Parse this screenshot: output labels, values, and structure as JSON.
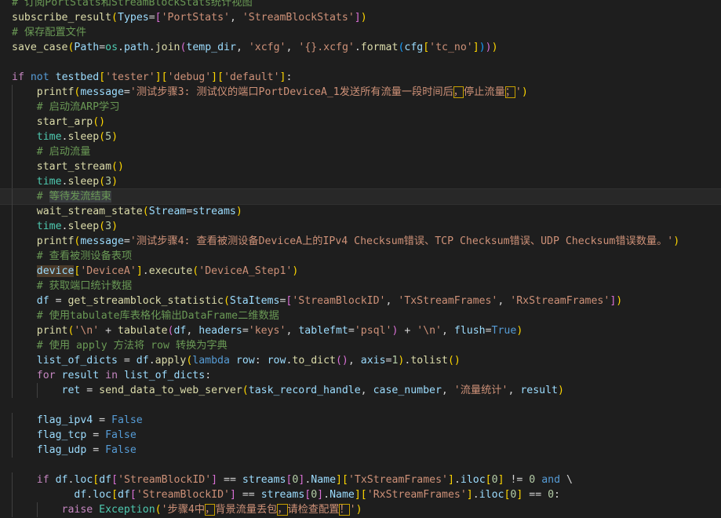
{
  "editor": {
    "lines": [
      {
        "indent": 0,
        "tokens": [
          [
            "com",
            "# 订阅PortStats和StreamBlockStats统计视图"
          ]
        ]
      },
      {
        "indent": 0,
        "tokens": [
          [
            "fn",
            "subscribe_result"
          ],
          [
            "p1",
            "("
          ],
          [
            "var",
            "Types"
          ],
          [
            "pun",
            "="
          ],
          [
            "p2",
            "["
          ],
          [
            "str",
            "'PortStats'"
          ],
          [
            "pun",
            ", "
          ],
          [
            "str",
            "'StreamBlockStats'"
          ],
          [
            "p2",
            "]"
          ],
          [
            "p1",
            ")"
          ]
        ]
      },
      {
        "indent": 0,
        "tokens": [
          [
            "com",
            "# 保存配置文件"
          ]
        ]
      },
      {
        "indent": 0,
        "tokens": [
          [
            "fn",
            "save_case"
          ],
          [
            "p1",
            "("
          ],
          [
            "var",
            "Path"
          ],
          [
            "pun",
            "="
          ],
          [
            "cls",
            "os"
          ],
          [
            "pun",
            "."
          ],
          [
            "var",
            "path"
          ],
          [
            "pun",
            "."
          ],
          [
            "fn",
            "join"
          ],
          [
            "p2",
            "("
          ],
          [
            "var",
            "temp_dir"
          ],
          [
            "pun",
            ", "
          ],
          [
            "str",
            "'xcfg'"
          ],
          [
            "pun",
            ", "
          ],
          [
            "str",
            "'{}.xcfg'"
          ],
          [
            "pun",
            "."
          ],
          [
            "fn",
            "format"
          ],
          [
            "p3",
            "("
          ],
          [
            "var",
            "cfg"
          ],
          [
            "p1",
            "["
          ],
          [
            "str",
            "'tc_no'"
          ],
          [
            "p1",
            "]"
          ],
          [
            "p3",
            ")"
          ],
          [
            "p2",
            ")"
          ],
          [
            "p1",
            ")"
          ]
        ]
      },
      {
        "indent": 0,
        "tokens": []
      },
      {
        "indent": 0,
        "tokens": [
          [
            "kw",
            "if"
          ],
          [
            "pun",
            " "
          ],
          [
            "kwb",
            "not"
          ],
          [
            "pun",
            " "
          ],
          [
            "var",
            "testbed"
          ],
          [
            "p1",
            "["
          ],
          [
            "str",
            "'tester'"
          ],
          [
            "p1",
            "]"
          ],
          [
            "p1",
            "["
          ],
          [
            "str",
            "'debug'"
          ],
          [
            "p1",
            "]"
          ],
          [
            "p1",
            "["
          ],
          [
            "str",
            "'default'"
          ],
          [
            "p1",
            "]"
          ],
          [
            "pun",
            ":"
          ]
        ]
      },
      {
        "indent": 1,
        "tokens": [
          [
            "fn",
            "printf"
          ],
          [
            "p1",
            "("
          ],
          [
            "var",
            "message"
          ],
          [
            "pun",
            "="
          ],
          [
            "str",
            "'测试步骤3: 测试仪的端口PortDeviceA_1发送所有流量一段时间后"
          ],
          [
            "box",
            "，"
          ],
          [
            "str",
            "停止流量"
          ],
          [
            "box",
            "；"
          ],
          [
            "str",
            "'"
          ],
          [
            "p1",
            ")"
          ]
        ]
      },
      {
        "indent": 1,
        "tokens": [
          [
            "com",
            "# 启动流ARP学习"
          ]
        ]
      },
      {
        "indent": 1,
        "tokens": [
          [
            "fn",
            "start_arp"
          ],
          [
            "p1",
            "()"
          ]
        ]
      },
      {
        "indent": 1,
        "tokens": [
          [
            "cls",
            "time"
          ],
          [
            "pun",
            "."
          ],
          [
            "fn",
            "sleep"
          ],
          [
            "p1",
            "("
          ],
          [
            "num",
            "5"
          ],
          [
            "p1",
            ")"
          ]
        ]
      },
      {
        "indent": 1,
        "tokens": [
          [
            "com",
            "# 启动流量"
          ]
        ]
      },
      {
        "indent": 1,
        "tokens": [
          [
            "fn",
            "start_stream"
          ],
          [
            "p1",
            "()"
          ]
        ]
      },
      {
        "indent": 1,
        "tokens": [
          [
            "cls",
            "time"
          ],
          [
            "pun",
            "."
          ],
          [
            "fn",
            "sleep"
          ],
          [
            "p1",
            "("
          ],
          [
            "num",
            "3"
          ],
          [
            "p1",
            ")"
          ]
        ]
      },
      {
        "indent": 1,
        "current": true,
        "tokens": [
          [
            "com",
            "# "
          ],
          [
            "hl",
            "等待发流结束"
          ]
        ]
      },
      {
        "indent": 1,
        "tokens": [
          [
            "fn",
            "wait_stream_state"
          ],
          [
            "p1",
            "("
          ],
          [
            "var",
            "Stream"
          ],
          [
            "pun",
            "="
          ],
          [
            "var",
            "streams"
          ],
          [
            "p1",
            ")"
          ]
        ]
      },
      {
        "indent": 1,
        "tokens": [
          [
            "cls",
            "time"
          ],
          [
            "pun",
            "."
          ],
          [
            "fn",
            "sleep"
          ],
          [
            "p1",
            "("
          ],
          [
            "num",
            "3"
          ],
          [
            "p1",
            ")"
          ]
        ]
      },
      {
        "indent": 1,
        "tokens": [
          [
            "fn",
            "printf"
          ],
          [
            "p1",
            "("
          ],
          [
            "var",
            "message"
          ],
          [
            "pun",
            "="
          ],
          [
            "str",
            "'测试步骤4: 查看被测设备DeviceA上的IPv4 Checksum错误、TCP Checksum错误、UDP Checksum错误数量。'"
          ],
          [
            "p1",
            ")"
          ]
        ]
      },
      {
        "indent": 1,
        "tokens": [
          [
            "com",
            "# 查看被测设备表项"
          ]
        ]
      },
      {
        "indent": 1,
        "tokens": [
          [
            "hlv",
            "device"
          ],
          [
            "p1",
            "["
          ],
          [
            "str",
            "'DeviceA'"
          ],
          [
            "p1",
            "]"
          ],
          [
            "pun",
            "."
          ],
          [
            "fn",
            "execute"
          ],
          [
            "p1",
            "("
          ],
          [
            "str",
            "'DeviceA_Step1'"
          ],
          [
            "p1",
            ")"
          ]
        ]
      },
      {
        "indent": 1,
        "tokens": [
          [
            "com",
            "# 获取端口统计数据"
          ]
        ]
      },
      {
        "indent": 1,
        "tokens": [
          [
            "var",
            "df"
          ],
          [
            "pun",
            " = "
          ],
          [
            "fn",
            "get_streamblock_statistic"
          ],
          [
            "p1",
            "("
          ],
          [
            "var",
            "StaItems"
          ],
          [
            "pun",
            "="
          ],
          [
            "p2",
            "["
          ],
          [
            "str",
            "'StreamBlockID'"
          ],
          [
            "pun",
            ", "
          ],
          [
            "str",
            "'TxStreamFrames'"
          ],
          [
            "pun",
            ", "
          ],
          [
            "str",
            "'RxStreamFrames'"
          ],
          [
            "p2",
            "]"
          ],
          [
            "p1",
            ")"
          ]
        ]
      },
      {
        "indent": 1,
        "tokens": [
          [
            "com",
            "# 使用tabulate库表格化输出DataFrame二维数据"
          ]
        ]
      },
      {
        "indent": 1,
        "tokens": [
          [
            "fn",
            "print"
          ],
          [
            "p1",
            "("
          ],
          [
            "str",
            "'\\n'"
          ],
          [
            "pun",
            " + "
          ],
          [
            "fn",
            "tabulate"
          ],
          [
            "p2",
            "("
          ],
          [
            "var",
            "df"
          ],
          [
            "pun",
            ", "
          ],
          [
            "var",
            "headers"
          ],
          [
            "pun",
            "="
          ],
          [
            "str",
            "'keys'"
          ],
          [
            "pun",
            ", "
          ],
          [
            "var",
            "tablefmt"
          ],
          [
            "pun",
            "="
          ],
          [
            "str",
            "'psql'"
          ],
          [
            "p2",
            ")"
          ],
          [
            "pun",
            " + "
          ],
          [
            "str",
            "'\\n'"
          ],
          [
            "pun",
            ", "
          ],
          [
            "var",
            "flush"
          ],
          [
            "pun",
            "="
          ],
          [
            "kwb",
            "True"
          ],
          [
            "p1",
            ")"
          ]
        ]
      },
      {
        "indent": 1,
        "tokens": [
          [
            "com",
            "# 使用 apply 方法将 row 转换为字典"
          ]
        ]
      },
      {
        "indent": 1,
        "tokens": [
          [
            "var",
            "list_of_dicts"
          ],
          [
            "pun",
            " = "
          ],
          [
            "var",
            "df"
          ],
          [
            "pun",
            "."
          ],
          [
            "fn",
            "apply"
          ],
          [
            "p1",
            "("
          ],
          [
            "kwb",
            "lambda"
          ],
          [
            "pun",
            " "
          ],
          [
            "var",
            "row"
          ],
          [
            "pun",
            ": "
          ],
          [
            "var",
            "row"
          ],
          [
            "pun",
            "."
          ],
          [
            "fn",
            "to_dict"
          ],
          [
            "p2",
            "()"
          ],
          [
            "pun",
            ", "
          ],
          [
            "var",
            "axis"
          ],
          [
            "pun",
            "="
          ],
          [
            "num",
            "1"
          ],
          [
            "p1",
            ")"
          ],
          [
            "pun",
            "."
          ],
          [
            "fn",
            "tolist"
          ],
          [
            "p1",
            "()"
          ]
        ]
      },
      {
        "indent": 1,
        "tokens": [
          [
            "kw",
            "for"
          ],
          [
            "pun",
            " "
          ],
          [
            "var",
            "result"
          ],
          [
            "pun",
            " "
          ],
          [
            "kw",
            "in"
          ],
          [
            "pun",
            " "
          ],
          [
            "var",
            "list_of_dicts"
          ],
          [
            "pun",
            ":"
          ]
        ]
      },
      {
        "indent": 2,
        "tokens": [
          [
            "var",
            "ret"
          ],
          [
            "pun",
            " = "
          ],
          [
            "fn",
            "send_data_to_web_server"
          ],
          [
            "p1",
            "("
          ],
          [
            "var",
            "task_record_handle"
          ],
          [
            "pun",
            ", "
          ],
          [
            "var",
            "case_number"
          ],
          [
            "pun",
            ", "
          ],
          [
            "str",
            "'流量统计'"
          ],
          [
            "pun",
            ", "
          ],
          [
            "var",
            "result"
          ],
          [
            "p1",
            ")"
          ]
        ]
      },
      {
        "indent": 0,
        "tokens": []
      },
      {
        "indent": 1,
        "tokens": [
          [
            "var",
            "flag_ipv4"
          ],
          [
            "pun",
            " = "
          ],
          [
            "kwb",
            "False"
          ]
        ]
      },
      {
        "indent": 1,
        "tokens": [
          [
            "var",
            "flag_tcp"
          ],
          [
            "pun",
            " = "
          ],
          [
            "kwb",
            "False"
          ]
        ]
      },
      {
        "indent": 1,
        "tokens": [
          [
            "var",
            "flag_udp"
          ],
          [
            "pun",
            " = "
          ],
          [
            "kwb",
            "False"
          ]
        ]
      },
      {
        "indent": 0,
        "tokens": []
      },
      {
        "indent": 1,
        "tokens": [
          [
            "kw",
            "if"
          ],
          [
            "pun",
            " "
          ],
          [
            "var",
            "df"
          ],
          [
            "pun",
            "."
          ],
          [
            "var",
            "loc"
          ],
          [
            "p1",
            "["
          ],
          [
            "var",
            "df"
          ],
          [
            "p2",
            "["
          ],
          [
            "str",
            "'StreamBlockID'"
          ],
          [
            "p2",
            "]"
          ],
          [
            "pun",
            " == "
          ],
          [
            "var",
            "streams"
          ],
          [
            "p2",
            "["
          ],
          [
            "num",
            "0"
          ],
          [
            "p2",
            "]"
          ],
          [
            "pun",
            "."
          ],
          [
            "var",
            "Name"
          ],
          [
            "p1",
            "]"
          ],
          [
            "p1",
            "["
          ],
          [
            "str",
            "'TxStreamFrames'"
          ],
          [
            "p1",
            "]"
          ],
          [
            "pun",
            "."
          ],
          [
            "var",
            "iloc"
          ],
          [
            "p1",
            "["
          ],
          [
            "num",
            "0"
          ],
          [
            "p1",
            "]"
          ],
          [
            "pun",
            " != "
          ],
          [
            "num",
            "0"
          ],
          [
            "pun",
            " "
          ],
          [
            "kwb",
            "and"
          ],
          [
            "pun",
            " \\"
          ]
        ]
      },
      {
        "indent": 1,
        "extra": 6,
        "tokens": [
          [
            "var",
            "df"
          ],
          [
            "pun",
            "."
          ],
          [
            "var",
            "loc"
          ],
          [
            "p1",
            "["
          ],
          [
            "var",
            "df"
          ],
          [
            "p2",
            "["
          ],
          [
            "str",
            "'StreamBlockID'"
          ],
          [
            "p2",
            "]"
          ],
          [
            "pun",
            " == "
          ],
          [
            "var",
            "streams"
          ],
          [
            "p2",
            "["
          ],
          [
            "num",
            "0"
          ],
          [
            "p2",
            "]"
          ],
          [
            "pun",
            "."
          ],
          [
            "var",
            "Name"
          ],
          [
            "p1",
            "]"
          ],
          [
            "p1",
            "["
          ],
          [
            "str",
            "'RxStreamFrames'"
          ],
          [
            "p1",
            "]"
          ],
          [
            "pun",
            "."
          ],
          [
            "var",
            "iloc"
          ],
          [
            "p1",
            "["
          ],
          [
            "num",
            "0"
          ],
          [
            "p1",
            "]"
          ],
          [
            "pun",
            " == "
          ],
          [
            "num",
            "0"
          ],
          [
            "pun",
            ":"
          ]
        ]
      },
      {
        "indent": 2,
        "tokens": [
          [
            "kw",
            "raise"
          ],
          [
            "pun",
            " "
          ],
          [
            "cls",
            "Exception"
          ],
          [
            "p1",
            "("
          ],
          [
            "str",
            "'步骤4中"
          ],
          [
            "box",
            "，"
          ],
          [
            "str",
            "背景流量丢包"
          ],
          [
            "box",
            "，"
          ],
          [
            "str",
            "请检查配置"
          ],
          [
            "box",
            "！"
          ],
          [
            "str",
            "'"
          ],
          [
            "p1",
            ")"
          ]
        ]
      }
    ]
  }
}
